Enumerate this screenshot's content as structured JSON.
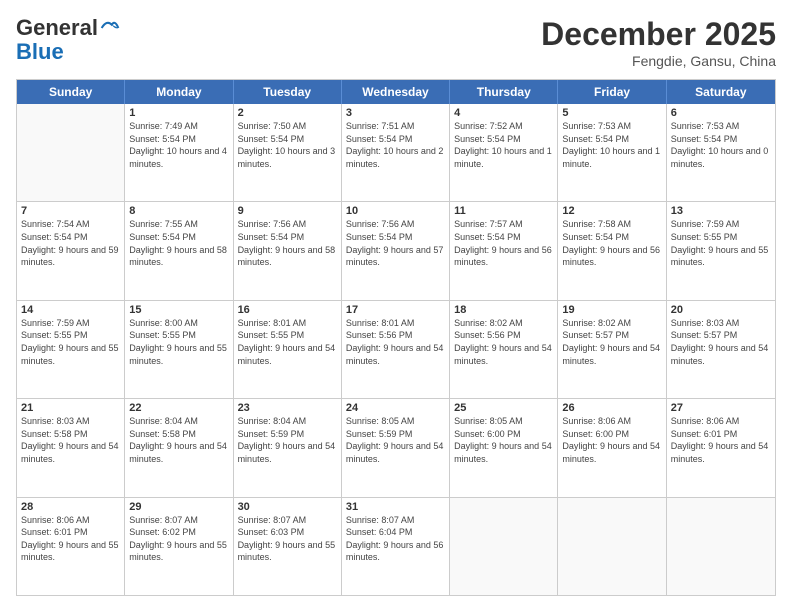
{
  "header": {
    "logo_general": "General",
    "logo_blue": "Blue",
    "month": "December 2025",
    "location": "Fengdie, Gansu, China"
  },
  "days_of_week": [
    "Sunday",
    "Monday",
    "Tuesday",
    "Wednesday",
    "Thursday",
    "Friday",
    "Saturday"
  ],
  "weeks": [
    [
      {
        "day": "",
        "empty": true
      },
      {
        "day": "1",
        "sunrise": "Sunrise: 7:49 AM",
        "sunset": "Sunset: 5:54 PM",
        "daylight": "Daylight: 10 hours and 4 minutes."
      },
      {
        "day": "2",
        "sunrise": "Sunrise: 7:50 AM",
        "sunset": "Sunset: 5:54 PM",
        "daylight": "Daylight: 10 hours and 3 minutes."
      },
      {
        "day": "3",
        "sunrise": "Sunrise: 7:51 AM",
        "sunset": "Sunset: 5:54 PM",
        "daylight": "Daylight: 10 hours and 2 minutes."
      },
      {
        "day": "4",
        "sunrise": "Sunrise: 7:52 AM",
        "sunset": "Sunset: 5:54 PM",
        "daylight": "Daylight: 10 hours and 1 minute."
      },
      {
        "day": "5",
        "sunrise": "Sunrise: 7:53 AM",
        "sunset": "Sunset: 5:54 PM",
        "daylight": "Daylight: 10 hours and 1 minute."
      },
      {
        "day": "6",
        "sunrise": "Sunrise: 7:53 AM",
        "sunset": "Sunset: 5:54 PM",
        "daylight": "Daylight: 10 hours and 0 minutes."
      }
    ],
    [
      {
        "day": "7",
        "sunrise": "Sunrise: 7:54 AM",
        "sunset": "Sunset: 5:54 PM",
        "daylight": "Daylight: 9 hours and 59 minutes."
      },
      {
        "day": "8",
        "sunrise": "Sunrise: 7:55 AM",
        "sunset": "Sunset: 5:54 PM",
        "daylight": "Daylight: 9 hours and 58 minutes."
      },
      {
        "day": "9",
        "sunrise": "Sunrise: 7:56 AM",
        "sunset": "Sunset: 5:54 PM",
        "daylight": "Daylight: 9 hours and 58 minutes."
      },
      {
        "day": "10",
        "sunrise": "Sunrise: 7:56 AM",
        "sunset": "Sunset: 5:54 PM",
        "daylight": "Daylight: 9 hours and 57 minutes."
      },
      {
        "day": "11",
        "sunrise": "Sunrise: 7:57 AM",
        "sunset": "Sunset: 5:54 PM",
        "daylight": "Daylight: 9 hours and 56 minutes."
      },
      {
        "day": "12",
        "sunrise": "Sunrise: 7:58 AM",
        "sunset": "Sunset: 5:54 PM",
        "daylight": "Daylight: 9 hours and 56 minutes."
      },
      {
        "day": "13",
        "sunrise": "Sunrise: 7:59 AM",
        "sunset": "Sunset: 5:55 PM",
        "daylight": "Daylight: 9 hours and 55 minutes."
      }
    ],
    [
      {
        "day": "14",
        "sunrise": "Sunrise: 7:59 AM",
        "sunset": "Sunset: 5:55 PM",
        "daylight": "Daylight: 9 hours and 55 minutes."
      },
      {
        "day": "15",
        "sunrise": "Sunrise: 8:00 AM",
        "sunset": "Sunset: 5:55 PM",
        "daylight": "Daylight: 9 hours and 55 minutes."
      },
      {
        "day": "16",
        "sunrise": "Sunrise: 8:01 AM",
        "sunset": "Sunset: 5:55 PM",
        "daylight": "Daylight: 9 hours and 54 minutes."
      },
      {
        "day": "17",
        "sunrise": "Sunrise: 8:01 AM",
        "sunset": "Sunset: 5:56 PM",
        "daylight": "Daylight: 9 hours and 54 minutes."
      },
      {
        "day": "18",
        "sunrise": "Sunrise: 8:02 AM",
        "sunset": "Sunset: 5:56 PM",
        "daylight": "Daylight: 9 hours and 54 minutes."
      },
      {
        "day": "19",
        "sunrise": "Sunrise: 8:02 AM",
        "sunset": "Sunset: 5:57 PM",
        "daylight": "Daylight: 9 hours and 54 minutes."
      },
      {
        "day": "20",
        "sunrise": "Sunrise: 8:03 AM",
        "sunset": "Sunset: 5:57 PM",
        "daylight": "Daylight: 9 hours and 54 minutes."
      }
    ],
    [
      {
        "day": "21",
        "sunrise": "Sunrise: 8:03 AM",
        "sunset": "Sunset: 5:58 PM",
        "daylight": "Daylight: 9 hours and 54 minutes."
      },
      {
        "day": "22",
        "sunrise": "Sunrise: 8:04 AM",
        "sunset": "Sunset: 5:58 PM",
        "daylight": "Daylight: 9 hours and 54 minutes."
      },
      {
        "day": "23",
        "sunrise": "Sunrise: 8:04 AM",
        "sunset": "Sunset: 5:59 PM",
        "daylight": "Daylight: 9 hours and 54 minutes."
      },
      {
        "day": "24",
        "sunrise": "Sunrise: 8:05 AM",
        "sunset": "Sunset: 5:59 PM",
        "daylight": "Daylight: 9 hours and 54 minutes."
      },
      {
        "day": "25",
        "sunrise": "Sunrise: 8:05 AM",
        "sunset": "Sunset: 6:00 PM",
        "daylight": "Daylight: 9 hours and 54 minutes."
      },
      {
        "day": "26",
        "sunrise": "Sunrise: 8:06 AM",
        "sunset": "Sunset: 6:00 PM",
        "daylight": "Daylight: 9 hours and 54 minutes."
      },
      {
        "day": "27",
        "sunrise": "Sunrise: 8:06 AM",
        "sunset": "Sunset: 6:01 PM",
        "daylight": "Daylight: 9 hours and 54 minutes."
      }
    ],
    [
      {
        "day": "28",
        "sunrise": "Sunrise: 8:06 AM",
        "sunset": "Sunset: 6:01 PM",
        "daylight": "Daylight: 9 hours and 55 minutes."
      },
      {
        "day": "29",
        "sunrise": "Sunrise: 8:07 AM",
        "sunset": "Sunset: 6:02 PM",
        "daylight": "Daylight: 9 hours and 55 minutes."
      },
      {
        "day": "30",
        "sunrise": "Sunrise: 8:07 AM",
        "sunset": "Sunset: 6:03 PM",
        "daylight": "Daylight: 9 hours and 55 minutes."
      },
      {
        "day": "31",
        "sunrise": "Sunrise: 8:07 AM",
        "sunset": "Sunset: 6:04 PM",
        "daylight": "Daylight: 9 hours and 56 minutes."
      },
      {
        "day": "",
        "empty": true
      },
      {
        "day": "",
        "empty": true
      },
      {
        "day": "",
        "empty": true
      }
    ]
  ]
}
